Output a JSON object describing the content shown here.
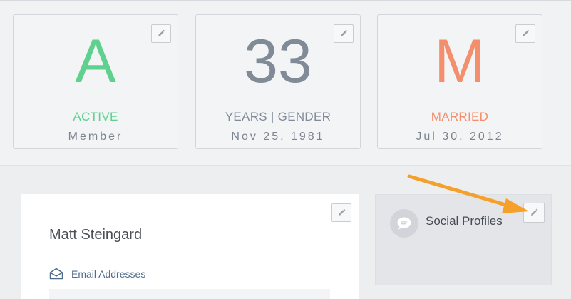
{
  "stats": [
    {
      "big": "A",
      "sub": "ACTIVE",
      "detail": "Member"
    },
    {
      "big": "33",
      "sub": "YEARS | GENDER",
      "detail": "Nov 25, 1981"
    },
    {
      "big": "M",
      "sub": "MARRIED",
      "detail": "Jul 30, 2012"
    }
  ],
  "colors": {
    "active": "#5fd18e",
    "age": "#818b97",
    "married": "#f48f6d",
    "arrow": "#f5a02a"
  },
  "icons": {
    "edit": "pencil-icon",
    "email": "envelope-icon",
    "social": "chat-bubble-icon"
  },
  "profile": {
    "name": "Matt Steingard",
    "email_label": "Email Addresses"
  },
  "social": {
    "label": "Social Profiles"
  }
}
